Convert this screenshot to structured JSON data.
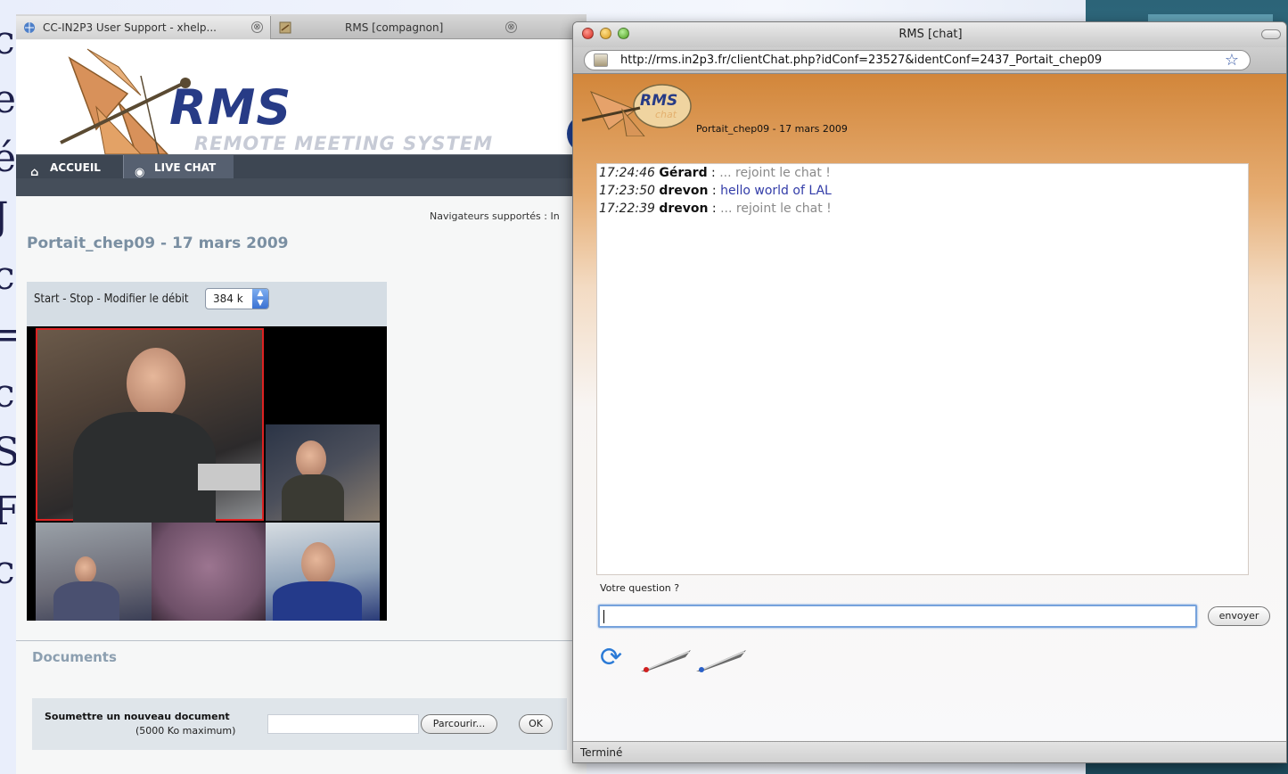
{
  "back_browser": {
    "tabs": [
      {
        "label": "CC-IN2P3 User Support - xhelp...",
        "close": "⊗"
      },
      {
        "label": "RMS [compagnon]",
        "close": "⊗"
      }
    ],
    "logo_text": "RMS",
    "logo_subtitle": "REMOTE MEETING SYSTEM",
    "nav": {
      "home": "ACCUEIL",
      "chat": "LIVE CHAT"
    },
    "supported_browsers": "Navigateurs supportés : In",
    "conference_title": "Portait_chep09 - 17 mars 2009",
    "video": {
      "controls_label": "Start - Stop - Modifier le débit",
      "bitrate": "384 k"
    },
    "documents": {
      "title": "Documents",
      "submit_label": "Soumettre un nouveau document",
      "submit_limit": "(5000 Ko maximum)",
      "file_value": "",
      "browse_button": "Parcourir...",
      "ok_button": "OK"
    }
  },
  "chat_window": {
    "title": "RMS [chat]",
    "url": "http://rms.in2p3.fr/clientChat.php?idConf=23527&identConf=2437_Portait_chep09",
    "logo_text": "RMS",
    "logo_sub": "chat",
    "conf_title": "Portait_chep09 - 17 mars 2009",
    "messages": [
      {
        "time": "17:24:46",
        "name": "Gérard",
        "sep": " : ",
        "text": "... rejoint le chat !",
        "style": "grey"
      },
      {
        "time": "17:23:50",
        "name": "drevon",
        "sep": " : ",
        "text": "hello world of LAL",
        "style": "blue"
      },
      {
        "time": "17:22:39",
        "name": "drevon",
        "sep": " : ",
        "text": "... rejoint le chat !",
        "style": "grey"
      }
    ],
    "question_label": "Votre question ?",
    "question_value": "",
    "send_button": "envoyer",
    "status": "Terminé"
  },
  "icons": {
    "home": "home-icon",
    "chat": "chat-bubble-icon",
    "refresh": "refresh-icon",
    "bookmark": "star-icon"
  },
  "colors": {
    "nav_bg": "#3d4652",
    "logo_blue": "#273b86",
    "chat_gradient_top": "#d2863a",
    "message_blue": "#323ca8",
    "focus_ring": "#76a2dc"
  }
}
